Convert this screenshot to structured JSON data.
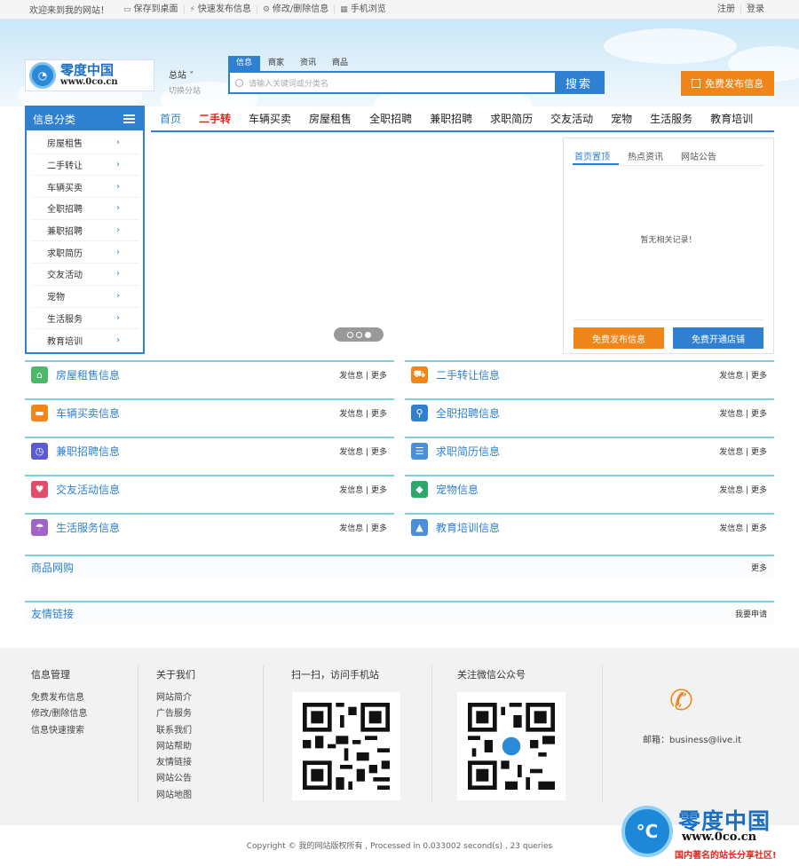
{
  "topbar": {
    "welcome": "欢迎来到我的网站！",
    "links": [
      {
        "icon": "monitor-icon",
        "label": "保存到桌面"
      },
      {
        "icon": "bolt-icon",
        "label": "快速发布信息"
      },
      {
        "icon": "gear-icon",
        "label": "修改/删除信息"
      },
      {
        "icon": "qr-icon",
        "label": "手机浏览"
      }
    ],
    "register": "注册",
    "login": "登录"
  },
  "header": {
    "logo_cn": "零度中国",
    "logo_url": "www.0co.cn",
    "station": "总站",
    "station_switch": "切换分站",
    "search_tabs": [
      "信息",
      "商家",
      "资讯",
      "商品"
    ],
    "search_placeholder": "请输入关键词或分类名",
    "search_button": "搜索",
    "publish_button": "免费发布信息"
  },
  "sidebar": {
    "title": "信息分类",
    "items": [
      "房屋租售",
      "二手转让",
      "车辆买卖",
      "全职招聘",
      "兼职招聘",
      "求职简历",
      "交友活动",
      "宠物",
      "生活服务",
      "教育培训"
    ]
  },
  "nav": [
    "首页",
    "二手转",
    "车辆买卖",
    "房屋租售",
    "全职招聘",
    "兼职招聘",
    "求职简历",
    "交友活动",
    "宠物",
    "生活服务",
    "教育培训"
  ],
  "newsbox": {
    "tabs": [
      "首页置顶",
      "热点资讯",
      "网站公告"
    ],
    "empty": "暂无相关记录！",
    "publish_button": "免费发布信息",
    "shop_button": "免费开通店铺"
  },
  "categories": [
    {
      "name": "房屋租售信息",
      "icon": "house-icon",
      "color": "#4cb86a"
    },
    {
      "name": "二手转让信息",
      "icon": "cart-icon",
      "color": "#f08519"
    },
    {
      "name": "车辆买卖信息",
      "icon": "car-icon",
      "color": "#f08519"
    },
    {
      "name": "全职招聘信息",
      "icon": "magnifier-user-icon",
      "color": "#2f80d1"
    },
    {
      "name": "兼职招聘信息",
      "icon": "clock-icon",
      "color": "#5b5bd6"
    },
    {
      "name": "求职简历信息",
      "icon": "document-icon",
      "color": "#4a90d9"
    },
    {
      "name": "交友活动信息",
      "icon": "heart-face-icon",
      "color": "#e24c6a"
    },
    {
      "name": "宠物信息",
      "icon": "dog-icon",
      "color": "#2ea86a"
    },
    {
      "name": "生活服务信息",
      "icon": "umbrella-icon",
      "color": "#a064c8"
    },
    {
      "name": "教育培训信息",
      "icon": "graduation-cap-icon",
      "color": "#4a90d9"
    }
  ],
  "category_more": "发信息 | 更多",
  "sections": {
    "goods_title": "商品网购",
    "goods_more": "更多",
    "links_title": "友情链接",
    "links_more": "我要申请"
  },
  "footer": {
    "col1_title": "信息管理",
    "col1_items": [
      "免费发布信息",
      "修改/删除信息",
      "信息快速搜索"
    ],
    "col2_title": "关于我们",
    "col2_items": [
      "网站简介",
      "广告服务",
      "联系我们",
      "网站帮助",
      "友情链接",
      "网站公告",
      "网站地图"
    ],
    "qr1_title": "扫一扫，访问手机站",
    "qr2_title": "关注微信公众号",
    "email": "邮箱：business@live.it",
    "copyright": "Copyright © 我的网站版权所有 , Processed in 0.033002 second(s) , 23 queries"
  },
  "watermark": {
    "cn": "零度中国",
    "url": "www.0co.cn",
    "slogan": "国内著名的站长分享社区!"
  },
  "colors": {
    "primary": "#2f80d1",
    "orange": "#f08519",
    "red": "#e0251b",
    "teal_line": "#7fcfe0"
  }
}
